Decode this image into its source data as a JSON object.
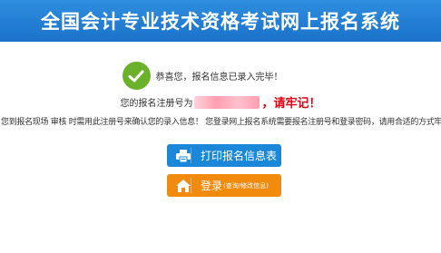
{
  "header": {
    "title": "全国会计专业技术资格考试网上报名系统"
  },
  "success": {
    "message": "恭喜您，报名信息已录入完毕！"
  },
  "registration": {
    "prefix": "您的报名注册号为",
    "number_masked": "",
    "remember": "，请牢记！"
  },
  "notice": {
    "text": "您到报名现场 审核 时需用此注册号来确认您的录入信息！ 您登录网上报名系统需要报名注册号和登录密码，请用合适的方式牢记"
  },
  "buttons": {
    "print_label": "打印报名信息表",
    "login_label": "登录",
    "login_sub": "(查询/修改信息)"
  },
  "colors": {
    "header_blue": "#1a72c9",
    "check_green": "#6bb12c",
    "print_blue": "#1a87d8",
    "login_orange": "#f28a0e",
    "remember_red": "#e60012"
  },
  "icons": {
    "success": "check-icon",
    "print": "printer-icon",
    "login": "home-icon"
  }
}
